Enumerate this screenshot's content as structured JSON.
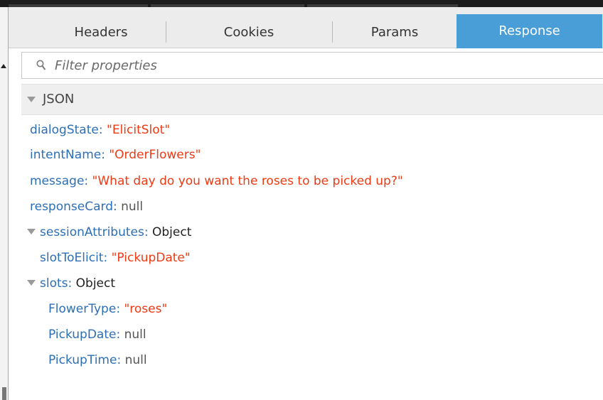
{
  "tabs": [
    "Headers",
    "Cookies",
    "Params",
    "Response"
  ],
  "active_tab": "Response",
  "filter": {
    "placeholder": "Filter properties"
  },
  "section": {
    "title": "JSON"
  },
  "props": {
    "dialogState": {
      "key": "dialogState",
      "value": "\"ElicitSlot\""
    },
    "intentName": {
      "key": "intentName",
      "value": "\"OrderFlowers\""
    },
    "message": {
      "key": "message",
      "value": "\"What day do you want the roses to be picked up?\""
    },
    "responseCard": {
      "key": "responseCard",
      "value": "null"
    },
    "sessionAttributes": {
      "key": "sessionAttributes",
      "value": "Object"
    },
    "slotToElicit": {
      "key": "slotToElicit",
      "value": "\"PickupDate\""
    },
    "slots": {
      "key": "slots",
      "value": "Object"
    },
    "FlowerType": {
      "key": "FlowerType",
      "value": "\"roses\""
    },
    "PickupDate": {
      "key": "PickupDate",
      "value": "null"
    },
    "PickupTime": {
      "key": "PickupTime",
      "value": "null"
    }
  }
}
